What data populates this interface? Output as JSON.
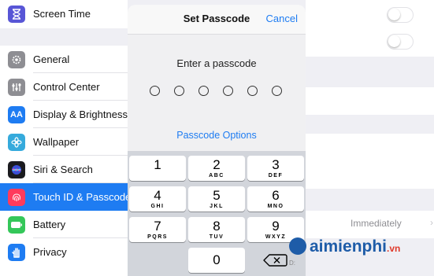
{
  "sidebar": {
    "items": [
      {
        "label": "Screen Time",
        "icon": "hourglass-icon",
        "color": "#5856d6"
      },
      {
        "label": "General",
        "icon": "gear-icon",
        "color": "#8e8e93"
      },
      {
        "label": "Control Center",
        "icon": "sliders-icon",
        "color": "#8e8e93"
      },
      {
        "label": "Display & Brightness",
        "icon": "aa-icon",
        "icon_text": "AA",
        "color": "#1e7cf2"
      },
      {
        "label": "Wallpaper",
        "icon": "flower-icon",
        "color": "#35aadc"
      },
      {
        "label": "Siri & Search",
        "icon": "siri-icon",
        "color": "#222"
      },
      {
        "label": "Touch ID & Passcode",
        "icon": "fingerprint-icon",
        "color": "#ff3b5c",
        "selected": true
      },
      {
        "label": "Battery",
        "icon": "battery-icon",
        "color": "#34c759"
      },
      {
        "label": "Privacy",
        "icon": "hand-icon",
        "color": "#1e7cf2"
      }
    ]
  },
  "modal": {
    "title": "Set Passcode",
    "cancel_label": "Cancel",
    "prompt": "Enter a passcode",
    "options_label": "Passcode Options"
  },
  "keypad": {
    "keys": [
      {
        "n": "1",
        "l": ""
      },
      {
        "n": "2",
        "l": "ABC"
      },
      {
        "n": "3",
        "l": "DEF"
      },
      {
        "n": "4",
        "l": "GHI"
      },
      {
        "n": "5",
        "l": "JKL"
      },
      {
        "n": "6",
        "l": "MNO"
      },
      {
        "n": "7",
        "l": "PQRS"
      },
      {
        "n": "8",
        "l": "TUV"
      },
      {
        "n": "9",
        "l": "WXYZ"
      },
      {
        "n": "0",
        "l": ""
      }
    ]
  },
  "right": {
    "require_value": "Immediately"
  },
  "watermark": {
    "brand": "aimienphi",
    "tld": ".vn",
    "tiny": "D:"
  },
  "colors": {
    "accent": "#1e7cf2",
    "selected_bg": "#1e7cf2"
  }
}
